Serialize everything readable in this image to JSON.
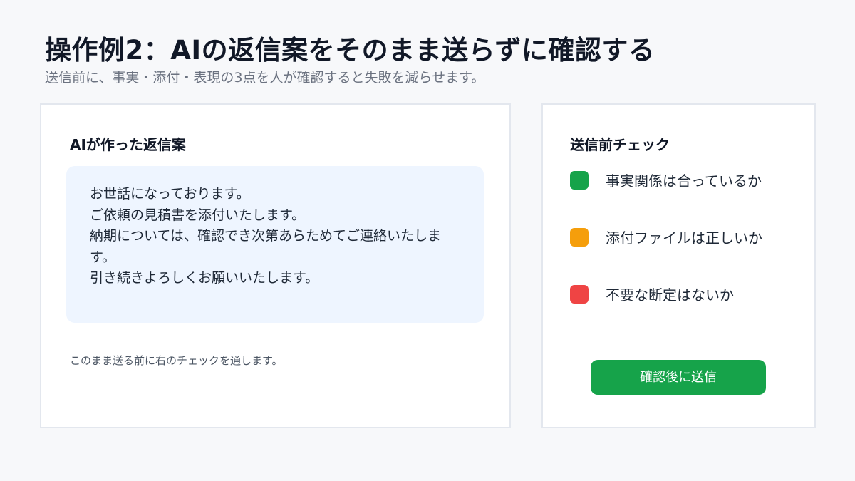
{
  "header": {
    "title": "操作例2：AIの返信案をそのまま送らずに確認する",
    "subtitle": "送信前に、事実・添付・表現の3点を人が確認すると失敗を減らせます。"
  },
  "draft_panel": {
    "heading": "AIが作った返信案",
    "lines": [
      "お世話になっております。",
      "ご依頼の見積書を添付いたします。",
      "納期については、確認でき次第あらためてご連絡いたしま",
      "す。",
      "引き続きよろしくお願いいたします。"
    ],
    "note": "このまま送る前に右のチェックを通します。"
  },
  "check_panel": {
    "heading": "送信前チェック",
    "items": [
      {
        "label": "事実関係は合っているか",
        "color": "#16a34a"
      },
      {
        "label": "添付ファイルは正しいか",
        "color": "#f59e0b"
      },
      {
        "label": "不要な断定はないか",
        "color": "#ef4444"
      }
    ],
    "button_label": "確認後に送信",
    "button_color": "#16a34a"
  }
}
